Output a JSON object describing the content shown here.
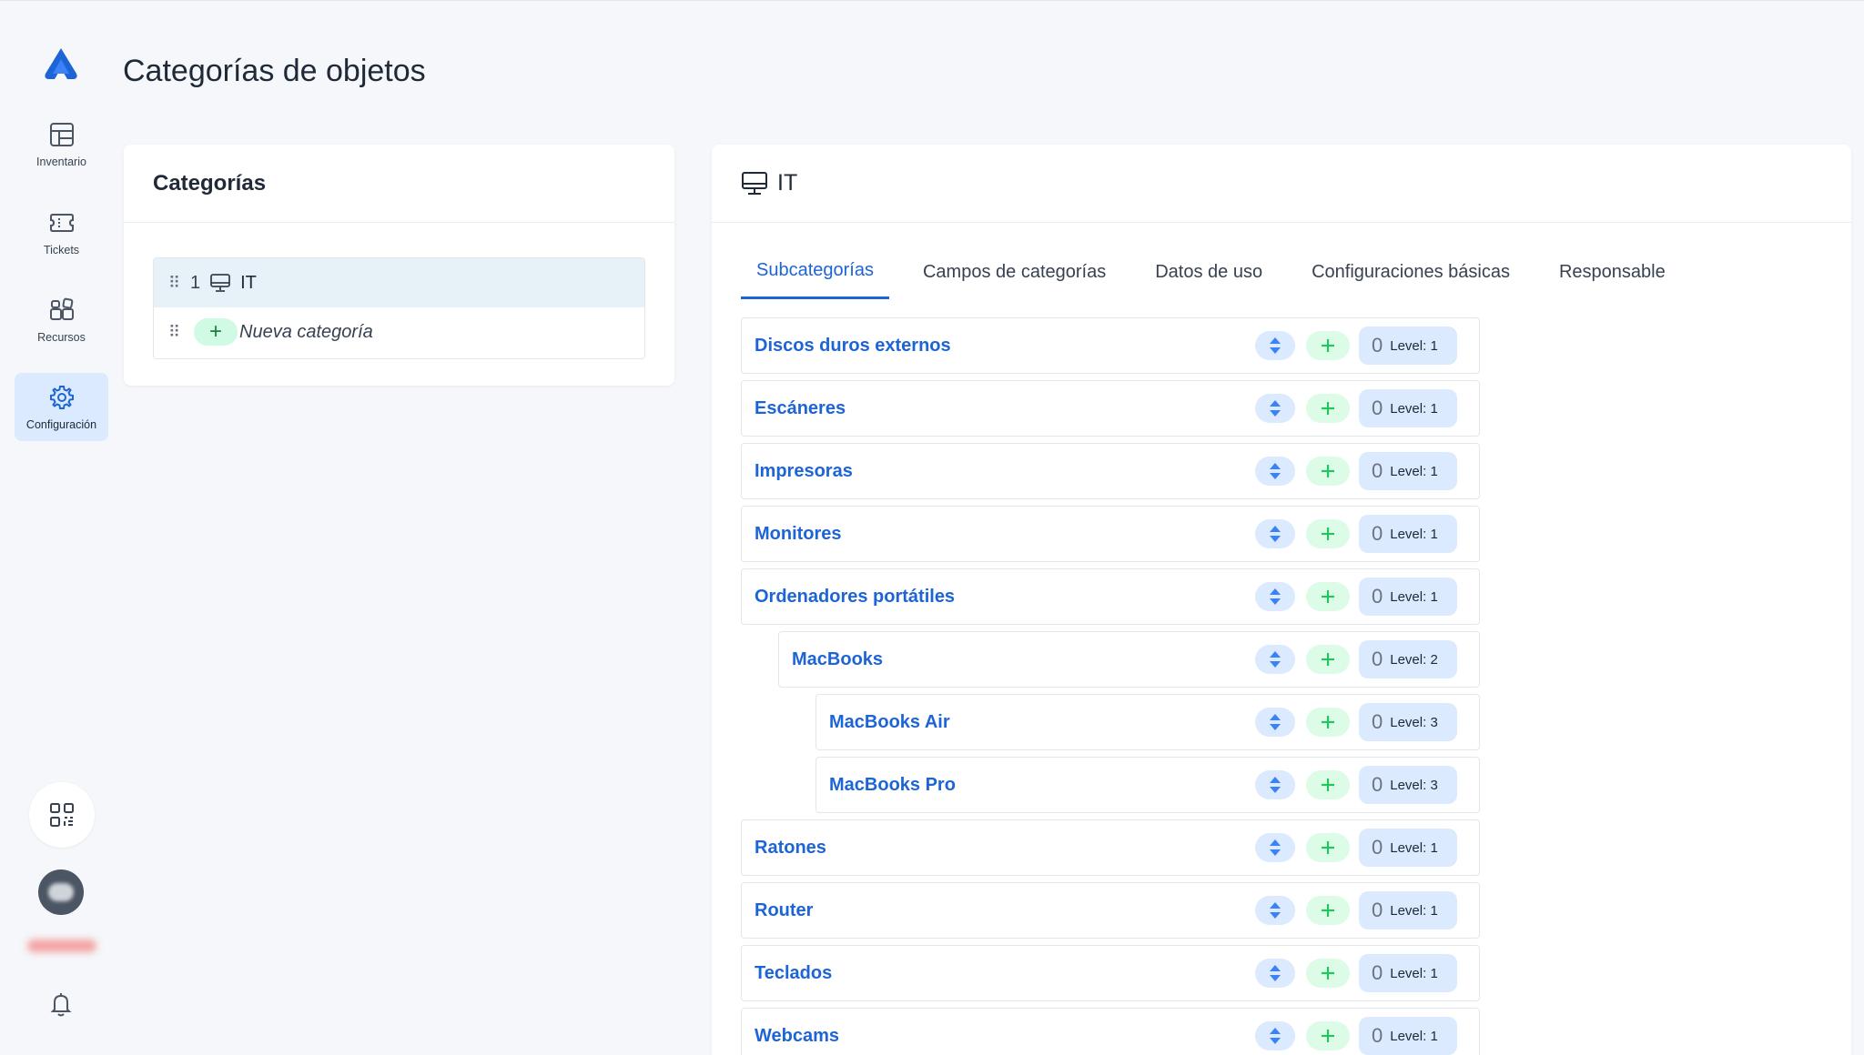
{
  "page": {
    "title": "Categorías de objetos"
  },
  "sidebar": {
    "items": [
      {
        "label": "Inventario",
        "icon": "table-icon"
      },
      {
        "label": "Tickets",
        "icon": "ticket-icon"
      },
      {
        "label": "Recursos",
        "icon": "resources-icon"
      },
      {
        "label": "Configuración",
        "icon": "gear-icon",
        "active": true
      }
    ]
  },
  "categories_panel": {
    "title": "Categorías",
    "items": [
      {
        "number": "1",
        "name": "IT",
        "icon": "monitor-icon"
      }
    ],
    "new_label": "Nueva categoría"
  },
  "detail": {
    "title": "IT",
    "tabs": [
      {
        "label": "Subcategorías",
        "active": true
      },
      {
        "label": "Campos de categorías"
      },
      {
        "label": "Datos de uso"
      },
      {
        "label": "Configuraciones básicas"
      },
      {
        "label": "Responsable"
      }
    ],
    "subcategories": [
      {
        "name": "Discos duros externos",
        "count": "0",
        "level": "Level: 1",
        "depth": 1
      },
      {
        "name": "Escáneres",
        "count": "0",
        "level": "Level: 1",
        "depth": 1
      },
      {
        "name": "Impresoras",
        "count": "0",
        "level": "Level: 1",
        "depth": 1
      },
      {
        "name": "Monitores",
        "count": "0",
        "level": "Level: 1",
        "depth": 1
      },
      {
        "name": "Ordenadores portátiles",
        "count": "0",
        "level": "Level: 1",
        "depth": 1
      },
      {
        "name": "MacBooks",
        "count": "0",
        "level": "Level: 2",
        "depth": 2
      },
      {
        "name": "MacBooks Air",
        "count": "0",
        "level": "Level: 3",
        "depth": 3
      },
      {
        "name": "MacBooks Pro",
        "count": "0",
        "level": "Level: 3",
        "depth": 3
      },
      {
        "name": "Ratones",
        "count": "0",
        "level": "Level: 1",
        "depth": 1
      },
      {
        "name": "Router",
        "count": "0",
        "level": "Level: 1",
        "depth": 1
      },
      {
        "name": "Teclados",
        "count": "0",
        "level": "Level: 1",
        "depth": 1
      },
      {
        "name": "Webcams",
        "count": "0",
        "level": "Level: 1",
        "depth": 1
      }
    ]
  },
  "colors": {
    "accent": "#1d64d6",
    "active_nav_bg": "#dbeafe",
    "add_green": "#16a34a"
  }
}
